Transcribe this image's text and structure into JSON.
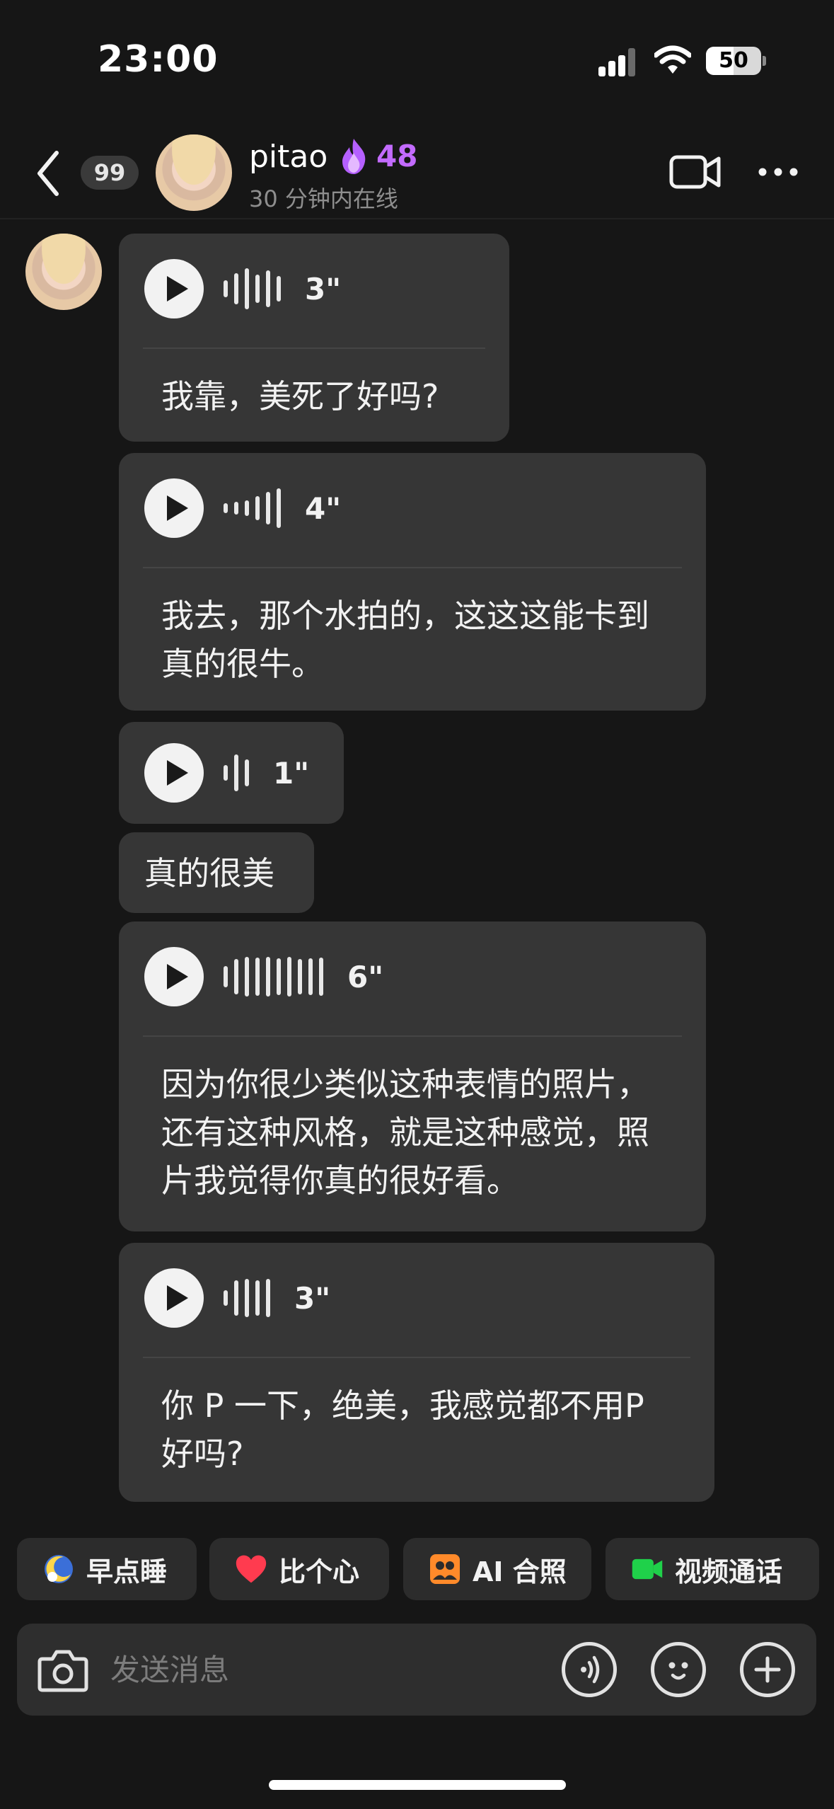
{
  "status_bar": {
    "time": "23:00",
    "battery": "50",
    "battery_level": 0.5
  },
  "header": {
    "unread_count": "99",
    "contact_name": "pitao",
    "streak_count": "48",
    "online_status": "30 分钟内在线"
  },
  "messages": [
    {
      "type": "voice",
      "duration": "3\"",
      "transcript": "我靠，美死了好吗?"
    },
    {
      "type": "voice",
      "duration": "4\"",
      "transcript": "我去，那个水拍的，这这这能卡到真的很牛。"
    },
    {
      "type": "voice",
      "duration": "1\""
    },
    {
      "type": "text",
      "text": "真的很美"
    },
    {
      "type": "voice",
      "duration": "6\"",
      "transcript": "因为你很少类似这种表情的照片，还有这种风格，就是这种感觉，照片我觉得你真的很好看。"
    },
    {
      "type": "voice",
      "duration": "3\"",
      "transcript": "你 P 一下，绝美，我感觉都不用P 好吗?"
    }
  ],
  "quick_actions": [
    {
      "label": "早点睡",
      "icon": "moon-icon"
    },
    {
      "label": "比个心",
      "icon": "heart-icon"
    },
    {
      "label": "AI 合照",
      "icon": "ai-photo-icon"
    },
    {
      "label": "视频通话",
      "icon": "video-icon"
    }
  ],
  "input": {
    "placeholder": "发送消息"
  },
  "colors": {
    "background": "#161616",
    "bubble": "#363636",
    "accent_purple": "#c36bff",
    "video_green": "#1fd14a",
    "heart_red": "#ff3b4f",
    "ai_orange": "#ff8a2a"
  }
}
